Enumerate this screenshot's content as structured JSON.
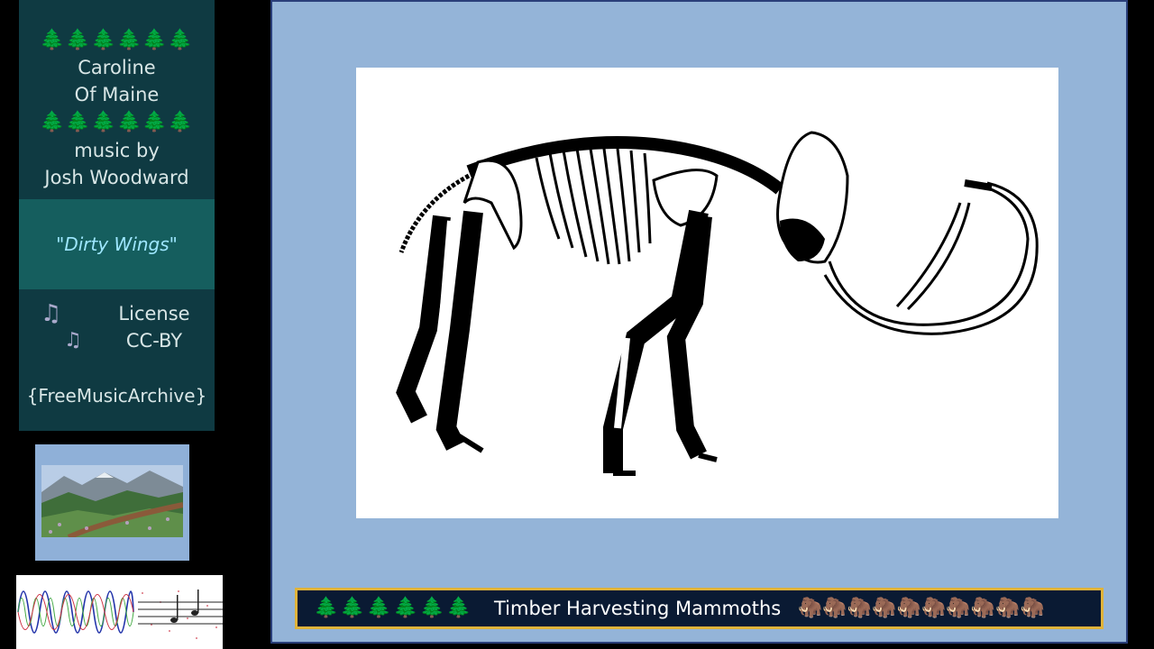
{
  "sidebar": {
    "trees_top": "🌲🌲🌲🌲🌲🌲",
    "trees_mid": "🌲🌲🌲🌲🌲🌲",
    "title_line1": "Caroline",
    "title_line2": "Of Maine",
    "byline_1": "music by",
    "byline_2": "Josh Woodward",
    "song_title": "\"Dirty Wings\"",
    "note_icon_1": "♫",
    "note_icon_2": "♫",
    "license_line1": "License",
    "license_line2": "CC-BY",
    "source": "{FreeMusicArchive}"
  },
  "thumbnails": {
    "landscape_icon": "landscape-painting",
    "spectrum_icon": "audio-spectrum"
  },
  "main": {
    "image_icon": "mammoth-skeleton-drawing",
    "caption": {
      "trees": "🌲🌲🌲🌲🌲🌲",
      "text": "Timber Harvesting Mammoths",
      "mammoths": "🦣🦣🦣🦣🦣🦣🦣🦣🦣🦣"
    }
  },
  "colors": {
    "panel_bg": "#0f3a42",
    "song_box_bg": "#155e5e",
    "song_title": "#9ee7ff",
    "main_bg": "#94b4d8",
    "caption_bg": "#0a1a33",
    "caption_border": "#e0b33a"
  }
}
